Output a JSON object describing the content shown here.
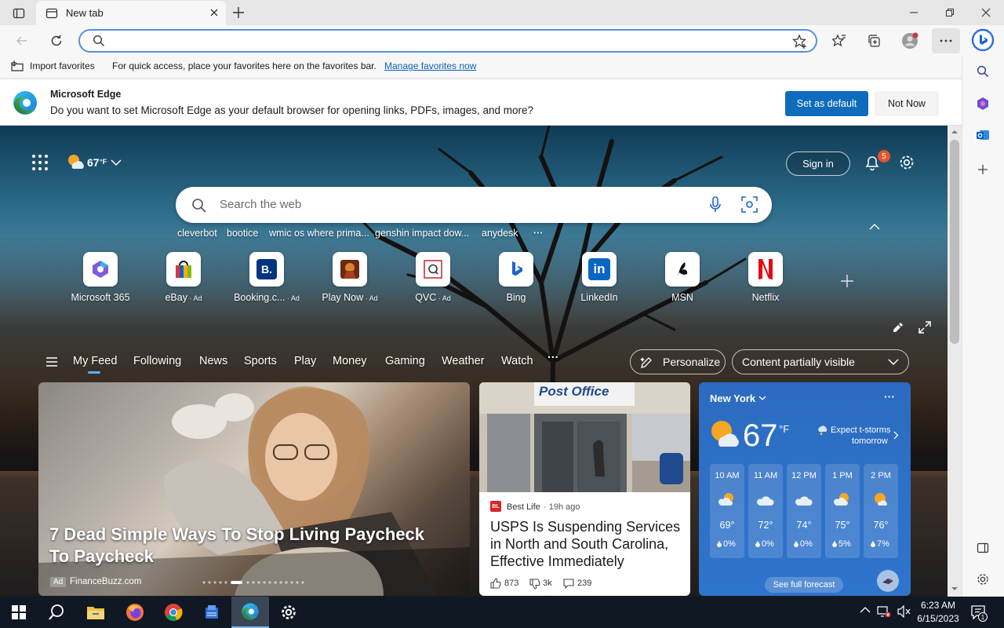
{
  "tab": {
    "title": "New tab"
  },
  "address": {
    "value": ""
  },
  "favorites_bar": {
    "import_label": "Import favorites",
    "hint": "For quick access, place your favorites here on the favorites bar.",
    "link": "Manage favorites now"
  },
  "infobar": {
    "title": "Microsoft Edge",
    "message": "Do you want to set Microsoft Edge as your default browser for opening links, PDFs, images, and more?",
    "primary_button": "Set as default",
    "secondary_button": "Not Now"
  },
  "page": {
    "weather_temp": "67",
    "weather_unit": "°F",
    "sign_in": "Sign in",
    "notif_count": "5",
    "search_placeholder": "Search the web",
    "trending": [
      "cleverbot",
      "bootice",
      "wmic os where prima...",
      "genshin impact dow...",
      "anydesk"
    ],
    "quick_links": [
      {
        "label": "Microsoft 365",
        "ad": ""
      },
      {
        "label": "eBay",
        "ad": " · Ad"
      },
      {
        "label": "Booking.c...",
        "ad": " · Ad"
      },
      {
        "label": "Play Now",
        "ad": " · Ad"
      },
      {
        "label": "QVC",
        "ad": " · Ad"
      },
      {
        "label": "Bing",
        "ad": ""
      },
      {
        "label": "LinkedIn",
        "ad": ""
      },
      {
        "label": "MSN",
        "ad": ""
      },
      {
        "label": "Netflix",
        "ad": ""
      }
    ],
    "feed_nav": [
      "My Feed",
      "Following",
      "News",
      "Sports",
      "Play",
      "Money",
      "Gaming",
      "Weather",
      "Watch"
    ],
    "personalize": "Personalize",
    "content_visibility": "Content partially visible"
  },
  "cards": {
    "main": {
      "headline": "7 Dead Simple Ways To Stop Living Paycheck To Paycheck",
      "ad_label": "Ad",
      "source": "FinanceBuzz.com"
    },
    "news": {
      "source": "Best Life",
      "time": "· 19h ago",
      "headline": "USPS Is Suspending Services in North and South Carolina, Effective Immediately",
      "likes": "873",
      "dislikes": "3k",
      "comments": "239",
      "sign_text": "Post Office"
    },
    "weather": {
      "city": "New York",
      "temp": "67",
      "unit": "°F",
      "forecast_note_1": "Expect t-storms",
      "forecast_note_2": "tomorrow",
      "hours": [
        {
          "time": "10 AM",
          "temp": "69°",
          "precip": "0%"
        },
        {
          "time": "11 AM",
          "temp": "72°",
          "precip": "0%"
        },
        {
          "time": "12 PM",
          "temp": "74°",
          "precip": "0%"
        },
        {
          "time": "1 PM",
          "temp": "75°",
          "precip": "5%"
        },
        {
          "time": "2 PM",
          "temp": "76°",
          "precip": "7%"
        }
      ],
      "see_forecast": "See full forecast"
    }
  },
  "taskbar": {
    "time": "6:23 AM",
    "date": "6/15/2023",
    "notif_badge": "1"
  },
  "colors": {
    "accent": "#0f6cbd",
    "taskbar": "#101823",
    "weather_card": "#2b6cc0"
  }
}
